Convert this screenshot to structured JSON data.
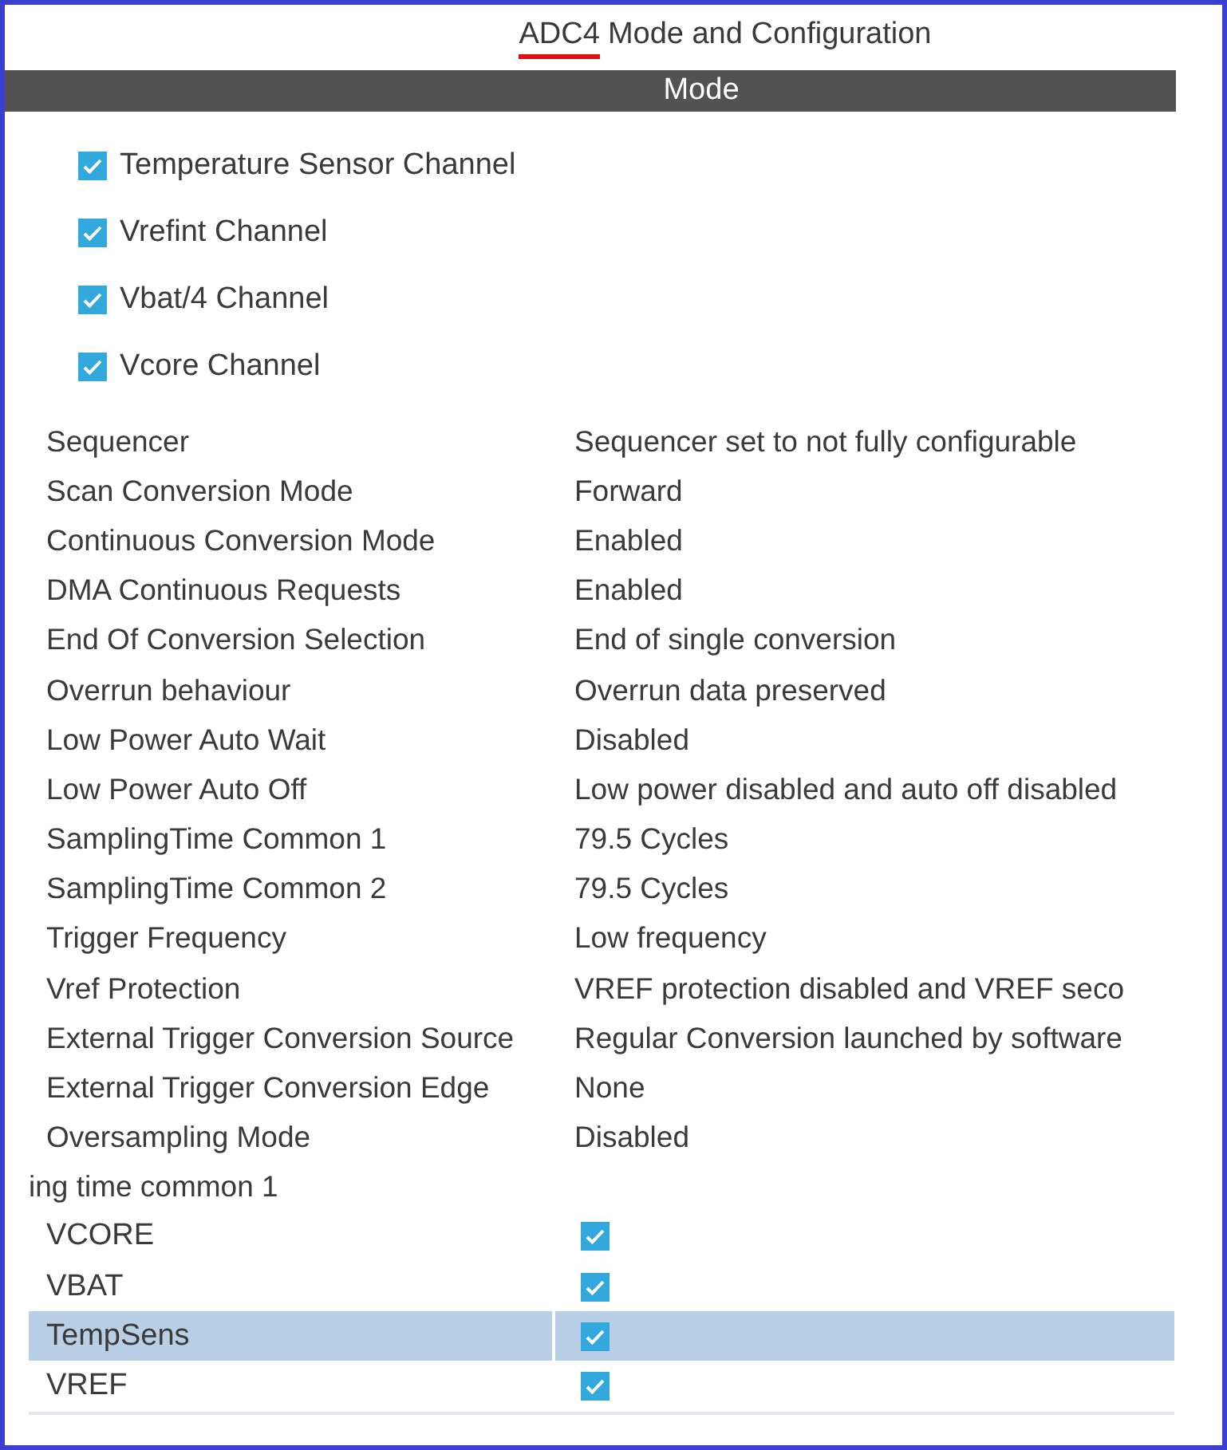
{
  "title": {
    "highlight": "ADC4",
    "rest": "Mode and Configuration"
  },
  "mode_bar": {
    "label": "Mode"
  },
  "mode_options": [
    {
      "label": "Temperature Sensor Channel",
      "checked": true
    },
    {
      "label": "Vrefint Channel",
      "checked": true
    },
    {
      "label": "Vbat/4 Channel",
      "checked": true
    },
    {
      "label": "Vcore Channel",
      "checked": true
    }
  ],
  "parameters": [
    {
      "name": "Sequencer",
      "value": "Sequencer set to not fully configurable"
    },
    {
      "name": "Scan Conversion Mode",
      "value": "Forward"
    },
    {
      "name": "Continuous Conversion Mode",
      "value": "Enabled"
    },
    {
      "name": "DMA Continuous Requests",
      "value": "Enabled"
    },
    {
      "name": "End Of Conversion Selection",
      "value": "End of single conversion"
    },
    {
      "name": "Overrun behaviour",
      "value": "Overrun data preserved"
    },
    {
      "name": "Low Power Auto Wait",
      "value": "Disabled"
    },
    {
      "name": "Low Power Auto Off",
      "value": "Low power disabled and auto off disabled"
    },
    {
      "name": "SamplingTime Common 1",
      "value": "79.5 Cycles"
    },
    {
      "name": "SamplingTime Common 2",
      "value": "79.5 Cycles"
    },
    {
      "name": "Trigger Frequency",
      "value": "Low frequency"
    },
    {
      "name": "Vref Protection",
      "value": "VREF protection disabled and VREF seco"
    },
    {
      "name": "External Trigger Conversion Source",
      "value": "Regular Conversion launched by software"
    },
    {
      "name": "External Trigger Conversion Edge",
      "value": "None"
    },
    {
      "name": "Oversampling Mode",
      "value": "Disabled"
    }
  ],
  "channel_section": {
    "title": "ing time common 1"
  },
  "channels": [
    {
      "name": "VCORE",
      "checked": true,
      "selected": false
    },
    {
      "name": "VBAT",
      "checked": true,
      "selected": false
    },
    {
      "name": "TempSens",
      "checked": true,
      "selected": true
    },
    {
      "name": "VREF",
      "checked": true,
      "selected": false
    }
  ]
}
